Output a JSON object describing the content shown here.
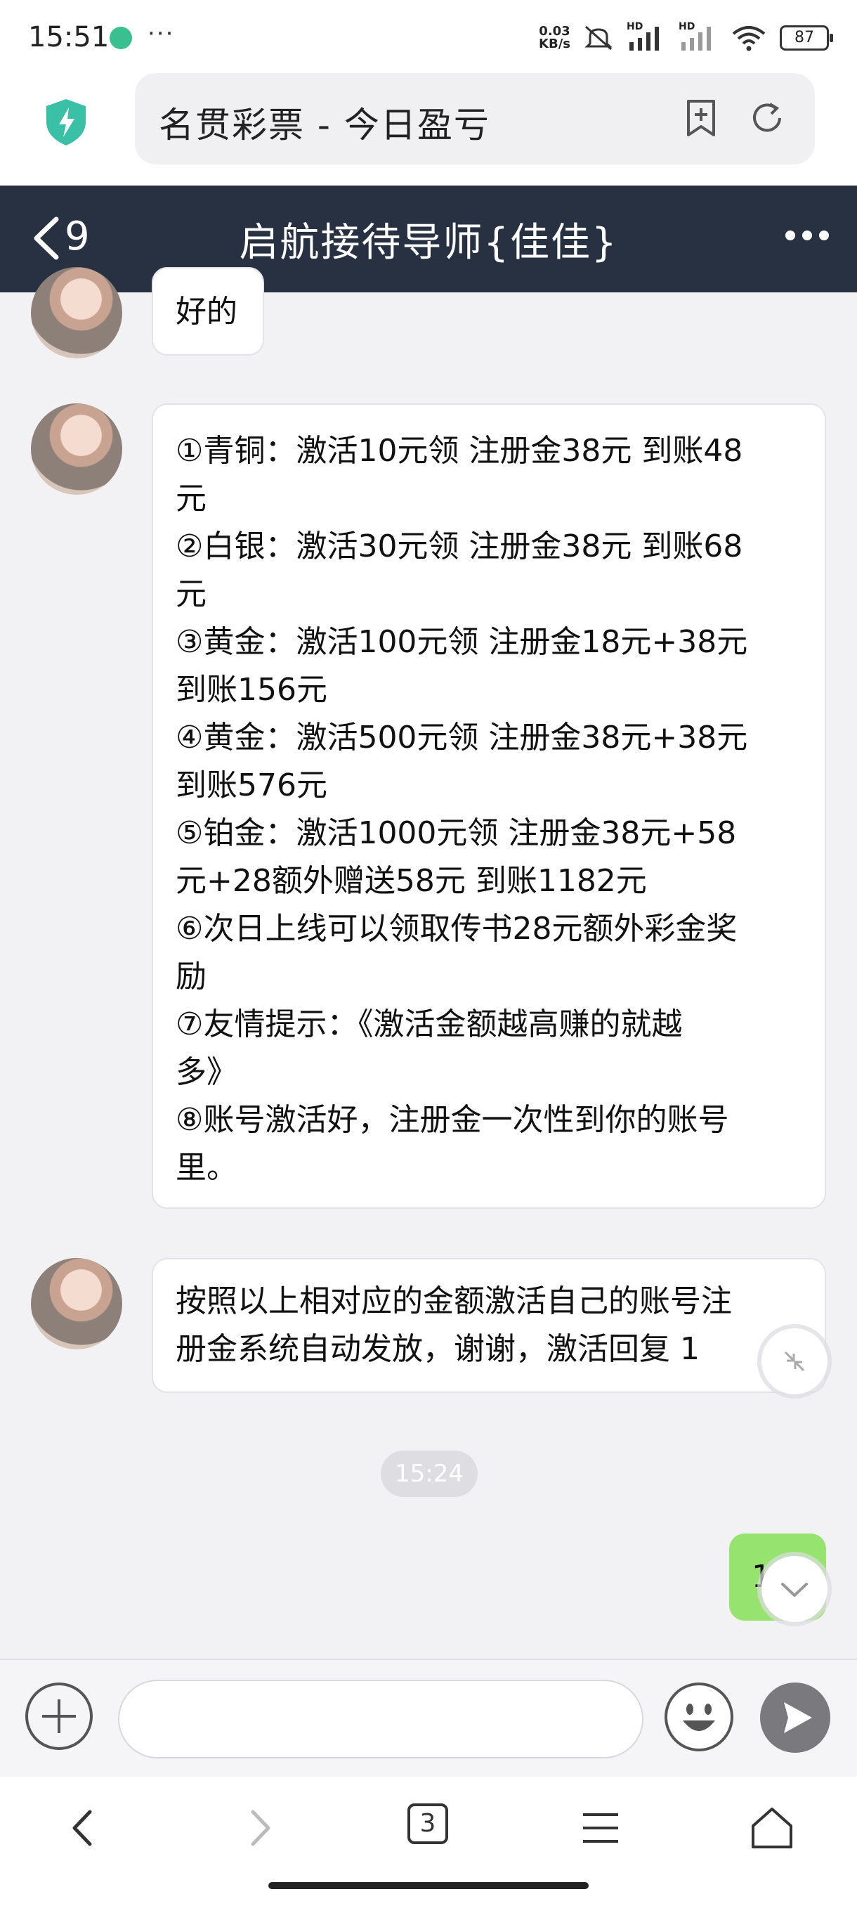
{
  "status_bar": {
    "time": "15:51",
    "dots": "···",
    "speed_value": "0.03",
    "speed_unit": "KB/s",
    "signal1": "HD",
    "signal2": "HD",
    "battery": "87"
  },
  "browser": {
    "url_title": "名贯彩票 - 今日盈亏",
    "shield_icon": "shield-lightning-icon",
    "bookmark_icon": "bookmark-add-icon",
    "refresh_icon": "refresh-icon"
  },
  "chat_header": {
    "unread_count": "9",
    "title": "启航接待导师{佳佳}",
    "more_icon": "more-dots-icon"
  },
  "messages": [
    {
      "sender": "other",
      "lines": [
        "好的"
      ]
    },
    {
      "sender": "other",
      "lines": [
        "①青铜：激活10元领 注册金38元 到账48",
        "元",
        "②白银：激活30元领 注册金38元 到账68",
        "元",
        "③黄金：激活100元领 注册金18元+38元",
        "到账156元",
        "④黄金：激活500元领 注册金38元+38元",
        "到账576元",
        "⑤铂金：激活1000元领 注册金38元+58",
        "元+28额外赠送58元 到账1182元",
        "⑥次日上线可以领取传书28元额外彩金奖",
        "励",
        "⑦友情提示：《激活金额越高赚的就越",
        "多》",
        "⑧账号激活好，注册金一次性到你的账号",
        "里。"
      ]
    },
    {
      "sender": "other",
      "lines": [
        "按照以上相对应的金额激活自己的账号注",
        "册金系统自动发放，谢谢，激活回复 1"
      ]
    }
  ],
  "timestamp": "15:24",
  "my_message": "1",
  "input_bar": {
    "placeholder": "",
    "plus_icon": "plus-circle-icon",
    "emoji_icon": "emoji-icon",
    "send_icon": "send-icon"
  },
  "nav_bar": {
    "tab_count": "3",
    "icons": [
      "back-icon",
      "forward-icon",
      "tabs-icon",
      "menu-icon",
      "home-icon"
    ]
  },
  "colors": {
    "header_bg": "#283142",
    "my_bubble": "#96e46f",
    "shield": "#3bc0a8"
  }
}
